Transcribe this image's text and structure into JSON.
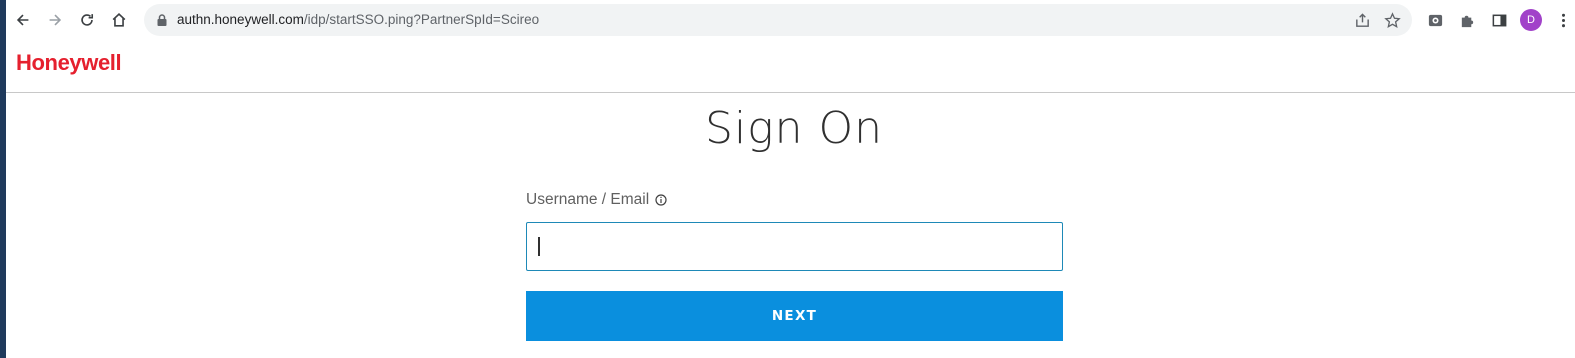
{
  "browser": {
    "url_domain": "authn.honeywell.com",
    "url_path": "/idp/startSSO.ping?PartnerSpId=Scireo",
    "profile_initial": "D",
    "profile_color": "#a142c9",
    "icons": [
      "back-icon",
      "forward-icon",
      "reload-icon",
      "home-icon",
      "lock-icon",
      "share-icon",
      "star-icon",
      "extension-app-icon",
      "puzzle-icon",
      "side-panel-icon",
      "menu-dots-icon"
    ]
  },
  "header": {
    "logo_text": "Honeywell",
    "logo_color": "#e5202e"
  },
  "main": {
    "title": "Sign On",
    "username_label": "Username / Email",
    "username_value": "",
    "next_label": "NEXT",
    "button_color": "#0a8fde"
  }
}
